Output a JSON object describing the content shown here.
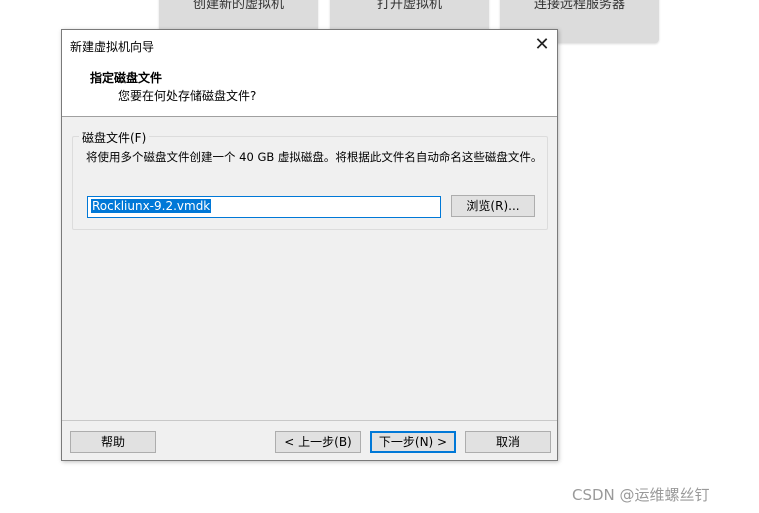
{
  "background_tiles": {
    "create": "创建新的虚拟机",
    "open": "打开虚拟机",
    "connect": "连接远程服务器"
  },
  "dialog": {
    "title": "新建虚拟机向导",
    "close_symbol": "✕",
    "header_title": "指定磁盘文件",
    "header_subtitle": "您要在何处存储磁盘文件?",
    "group_label": "磁盘文件(F)",
    "group_description": "将使用多个磁盘文件创建一个 40 GB 虚拟磁盘。将根据此文件名自动命名这些磁盘文件。",
    "file_value": "Rockliunx-9.2.vmdk",
    "browse_label": "浏览(R)...",
    "buttons": {
      "help": "帮助",
      "back": "< 上一步(B)",
      "next": "下一步(N) >",
      "cancel": "取消"
    }
  },
  "watermark": "CSDN @运维螺丝钉",
  "colors": {
    "accent": "#0078d7",
    "dialog_bg": "#f0f0f0",
    "button_bg": "#e1e1e1"
  }
}
